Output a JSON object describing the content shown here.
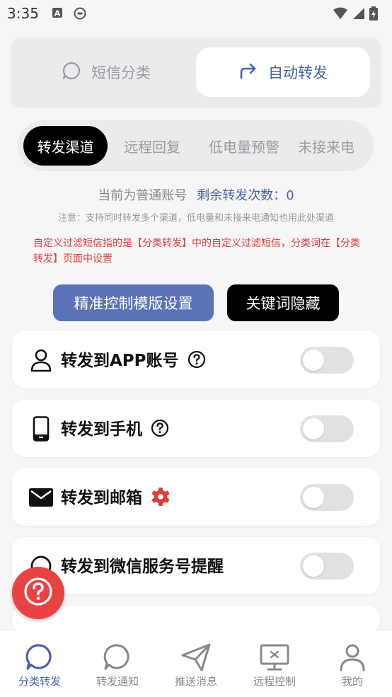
{
  "status_bar": {
    "time": "3:35"
  },
  "top_segment": {
    "left_label": "短信分类",
    "right_label": "自动转发"
  },
  "tabs": [
    "转发渠道",
    "远程回复",
    "低电量预警",
    "未接来电"
  ],
  "account": {
    "type_text": "当前为普通账号",
    "remaining_label": "剩余转发次数：",
    "remaining_count": "0"
  },
  "note": "注意：支持同时转发多个渠道，低电量和未接来电通知也用此处渠道",
  "filter_note": "自定义过滤短信指的是【分类转发】中的自定义过滤短信，分类词在【分类转发】页面中设置",
  "buttons": {
    "template_settings": "精准控制模版设置",
    "hide_keywords": "关键词隐藏"
  },
  "channels": [
    {
      "title": "转发到APP账号",
      "icon": "user-icon",
      "extra": "help-icon",
      "enabled": false
    },
    {
      "title": "转发到手机",
      "icon": "phone-icon",
      "extra": "help-icon",
      "enabled": false
    },
    {
      "title": "转发到邮箱",
      "icon": "mail-icon",
      "extra": "gear-icon",
      "enabled": false
    },
    {
      "title": "转发到微信服务号提醒",
      "icon": "chat-icon",
      "extra": "",
      "enabled": false
    }
  ],
  "bottom_nav": [
    {
      "label": "分类转发",
      "icon": "chat-bubble-icon",
      "active": true
    },
    {
      "label": "转发通知",
      "icon": "chat-bubble-icon",
      "active": false
    },
    {
      "label": "推送消息",
      "icon": "send-icon",
      "active": false
    },
    {
      "label": "远程控制",
      "icon": "monitor-icon",
      "active": false
    },
    {
      "label": "我的",
      "icon": "profile-icon",
      "active": false
    }
  ],
  "colors": {
    "accent": "#4a63a6",
    "button_blue": "#5b72b8",
    "warning_red": "#e23b3b",
    "fab_red": "#e84343"
  }
}
